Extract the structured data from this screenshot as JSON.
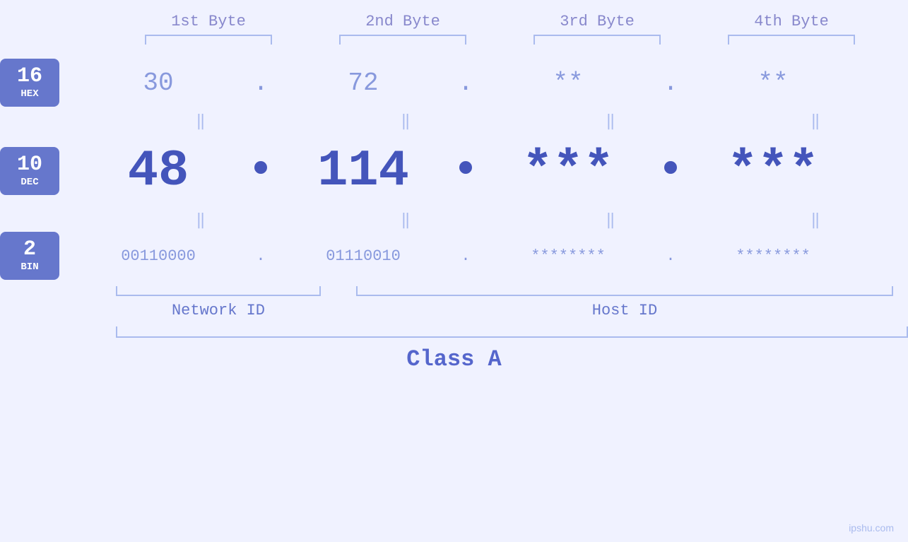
{
  "header": {
    "byte1": "1st Byte",
    "byte2": "2nd Byte",
    "byte3": "3rd Byte",
    "byte4": "4th Byte"
  },
  "badges": {
    "hex": {
      "num": "16",
      "label": "HEX"
    },
    "dec": {
      "num": "10",
      "label": "DEC"
    },
    "bin": {
      "num": "2",
      "label": "BIN"
    }
  },
  "hex_row": {
    "val1": "30",
    "val2": "72",
    "val3": "**",
    "val4": "**",
    "dot": "."
  },
  "dec_row": {
    "val1": "48",
    "val2": "114",
    "val3": "***",
    "val4": "***"
  },
  "bin_row": {
    "val1": "00110000",
    "val2": "01110010",
    "val3": "********",
    "val4": "********",
    "dot": "."
  },
  "labels": {
    "network_id": "Network ID",
    "host_id": "Host ID",
    "class": "Class A"
  },
  "watermark": "ipshu.com"
}
